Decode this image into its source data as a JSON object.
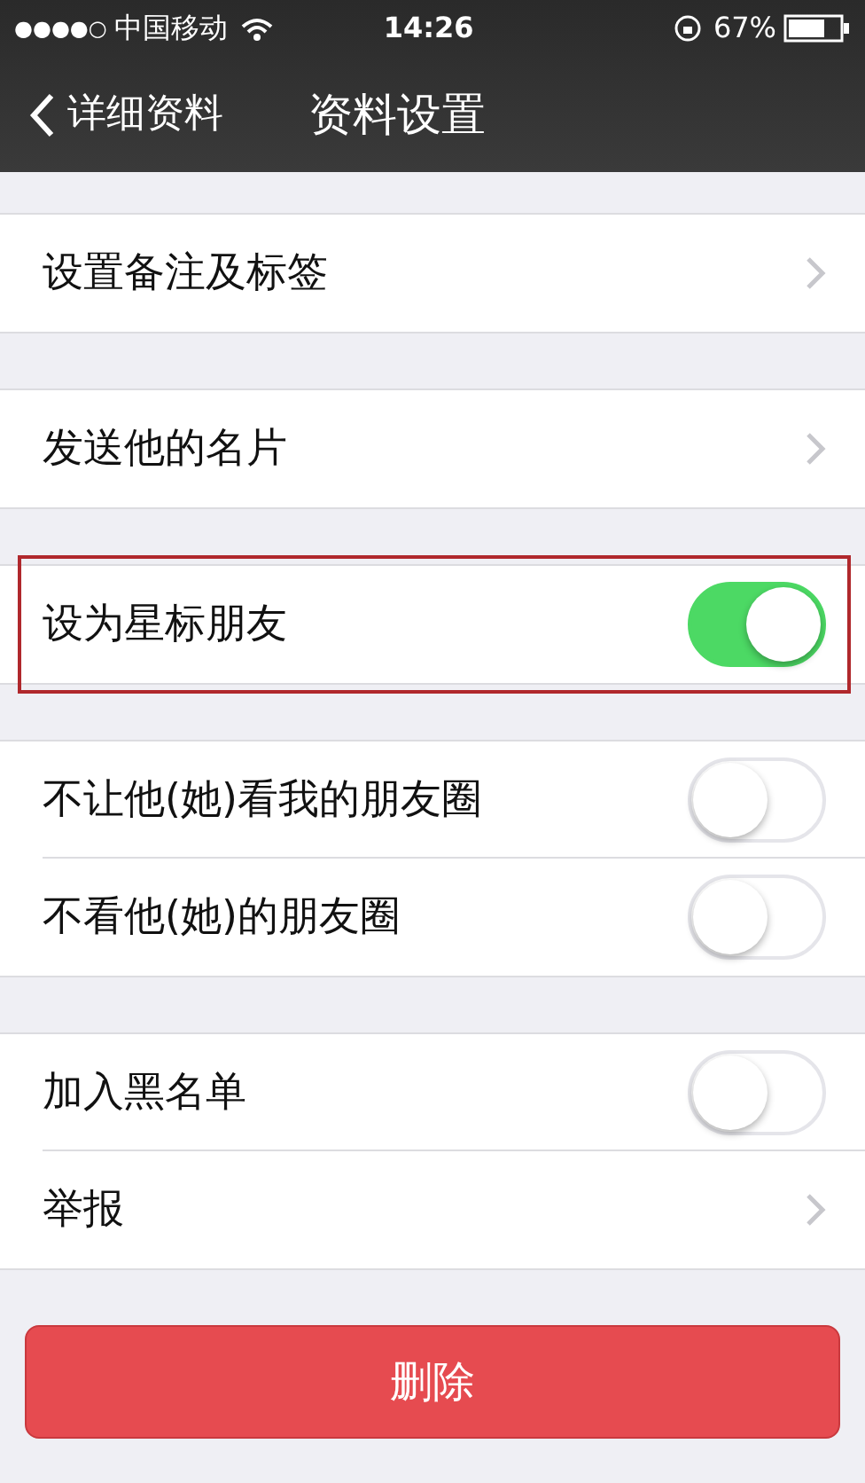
{
  "status_bar": {
    "signal": "●●●●○",
    "carrier": "中国移动",
    "time": "14:26",
    "battery": "67%"
  },
  "nav_bar": {
    "back": "详细资料",
    "title": "资料设置"
  },
  "groups": [
    {
      "rows": [
        {
          "kind": "link",
          "label": "设置备注及标签",
          "highlighted": false
        }
      ]
    },
    {
      "rows": [
        {
          "kind": "link",
          "label": "发送他的名片",
          "highlighted": false
        }
      ]
    },
    {
      "rows": [
        {
          "kind": "toggle",
          "label": "设为星标朋友",
          "on": true,
          "highlighted": true
        }
      ]
    },
    {
      "rows": [
        {
          "kind": "toggle",
          "label": "不让他(她)看我的朋友圈",
          "on": false,
          "highlighted": false
        },
        {
          "kind": "toggle",
          "label": "不看他(她)的朋友圈",
          "on": false,
          "highlighted": false
        }
      ]
    },
    {
      "rows": [
        {
          "kind": "toggle",
          "label": "加入黑名单",
          "on": false,
          "highlighted": false
        },
        {
          "kind": "link",
          "label": "举报",
          "highlighted": false
        }
      ]
    }
  ],
  "delete_button": "删除"
}
